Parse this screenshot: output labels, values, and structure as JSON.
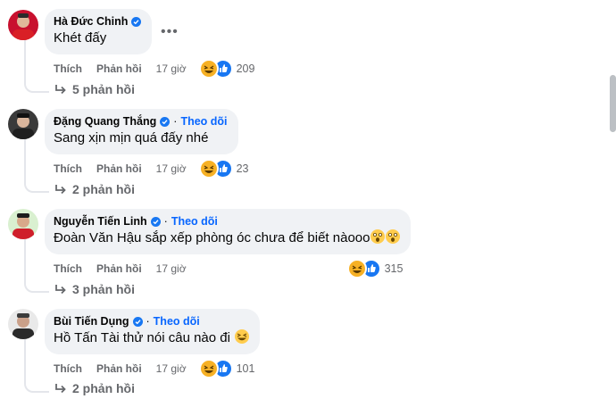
{
  "labels": {
    "like": "Thích",
    "reply": "Phản hồi",
    "follow": "Theo dõi",
    "dot": "·",
    "more": "•••"
  },
  "comments": [
    {
      "author": "Hà Đức Chinh",
      "text": "Khét đấy",
      "time": "17 giờ",
      "reactions": "209",
      "replies": "5 phản hồi",
      "verified": true,
      "show_follow": false
    },
    {
      "author": "Đặng Quang Thắng",
      "text": "Sang xịn mịn quá đấy nhé",
      "time": "17 giờ",
      "reactions": "23",
      "replies": "2 phản hồi",
      "verified": true,
      "show_follow": true
    },
    {
      "author": "Nguyễn Tiến Linh",
      "text": "Đoàn Văn Hậu sắp xếp phòng óc chưa để biết nàooo",
      "text_emojis": [
        "astonished-face-emoji",
        "astonished-face-emoji"
      ],
      "time": "17 giờ",
      "reactions": "315",
      "replies": "3 phản hồi",
      "verified": true,
      "show_follow": true
    },
    {
      "author": "Bùi Tiến Dụng",
      "text": "Hồ Tấn Tài thử nói câu nào đi",
      "text_emojis": [
        "grinning-squinting-face-emoji"
      ],
      "time": "17 giờ",
      "reactions": "101",
      "replies": "2 phản hồi",
      "verified": true,
      "show_follow": true
    }
  ],
  "colors": {
    "bubble": "#f0f2f5",
    "link_blue": "#0866ff",
    "verified_blue": "#1877f2",
    "meta_gray": "#65676b",
    "haha_yellow": "#f7b125"
  }
}
